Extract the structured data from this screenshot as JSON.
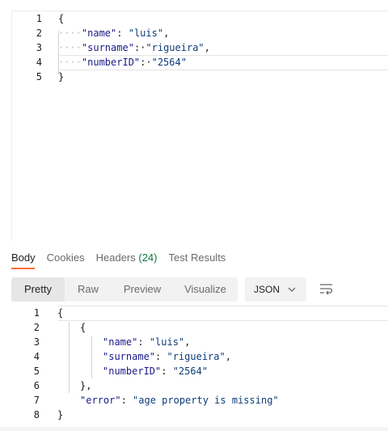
{
  "request_body": {
    "lines": [
      {
        "num": "1",
        "text": "{"
      },
      {
        "num": "2",
        "key": "\"name\"",
        "value": "\"luis\"",
        "trail": ","
      },
      {
        "num": "3",
        "key": "\"surname\"",
        "value": "\"rigueira\"",
        "trail": ","
      },
      {
        "num": "4",
        "key": "\"numberID\"",
        "value": "\"2564\"",
        "trail": ""
      },
      {
        "num": "5",
        "text": "}"
      }
    ]
  },
  "response_tabs": [
    {
      "label": "Body"
    },
    {
      "label": "Cookies"
    },
    {
      "label": "Headers",
      "count": "(24)"
    },
    {
      "label": "Test Results"
    }
  ],
  "format_buttons": [
    "Pretty",
    "Raw",
    "Preview",
    "Visualize"
  ],
  "language_select": {
    "value": "JSON"
  },
  "response_body": {
    "lines": [
      {
        "num": "1",
        "text": "{"
      },
      {
        "num": "2",
        "text": "{"
      },
      {
        "num": "3",
        "key": "\"name\"",
        "value": "\"luis\"",
        "trail": ","
      },
      {
        "num": "4",
        "key": "\"surname\"",
        "value": "\"rigueira\"",
        "trail": ","
      },
      {
        "num": "5",
        "key": "\"numberID\"",
        "value": "\"2564\"",
        "trail": ""
      },
      {
        "num": "6",
        "text": "},"
      },
      {
        "num": "7",
        "key": "\"error\"",
        "value": "\"age property is missing\"",
        "trail": ""
      },
      {
        "num": "8",
        "text": "}"
      }
    ]
  },
  "colors": {
    "accent": "#ff6c37",
    "count_green": "#0a7a3d",
    "key": "#1a1a8a",
    "string": "#0d3b7a"
  },
  "icons": {
    "chevron": "chevron-down-icon",
    "wrap": "word-wrap-icon"
  }
}
